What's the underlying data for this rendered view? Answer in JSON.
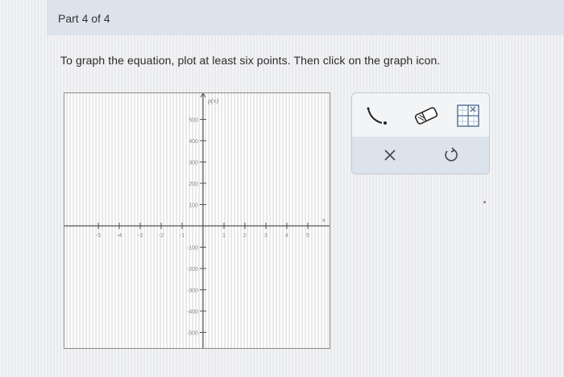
{
  "header": {
    "part_label": "Part 4 of 4"
  },
  "instruction": "To graph the equation, plot at least six points. Then click on the graph icon.",
  "graph": {
    "y_axis_label": "p(x)",
    "x_axis_label": "x",
    "x_ticks": [
      "-5",
      "-4",
      "-3",
      "-2",
      "-1",
      "1",
      "2",
      "3",
      "4",
      "5"
    ],
    "y_ticks": [
      "500",
      "400",
      "300",
      "200",
      "100",
      "-100",
      "-200",
      "-300",
      "-400",
      "-500"
    ]
  },
  "toolbox": {
    "tools": [
      "curve-tool-icon",
      "eraser-icon",
      "graph-icon"
    ],
    "actions": [
      "clear-icon",
      "undo-icon"
    ],
    "accent": "#4a6a8f"
  }
}
